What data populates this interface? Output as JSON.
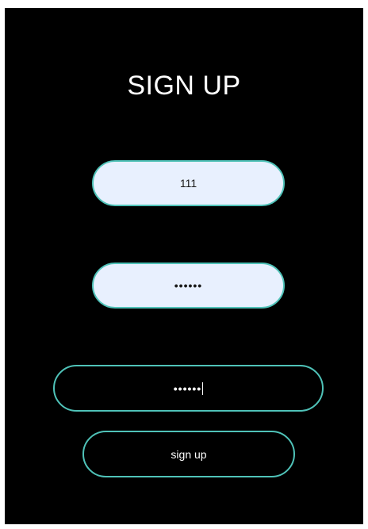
{
  "form": {
    "title": "SIGN UP",
    "username": {
      "value": "111"
    },
    "password": {
      "masked_value": "••••••"
    },
    "confirm_password": {
      "masked_value": "••••••"
    },
    "submit_label": "sign up"
  },
  "colors": {
    "background": "#000000",
    "accent_border": "#4fc2b8",
    "filled_input": "#e8f0fe",
    "text_light": "#ffffff",
    "text_dark": "#1a1a1a"
  }
}
